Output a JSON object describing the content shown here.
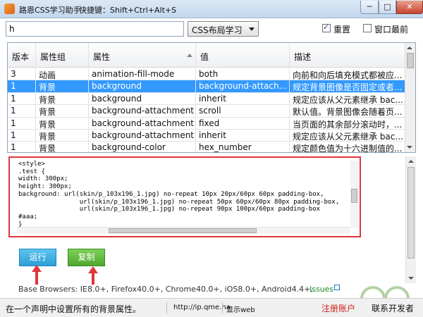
{
  "window": {
    "title": "路恩CSS学习助手",
    "shortcut": "快捷键：Shift+Ctrl+Alt+S",
    "minimize_symbol": "─",
    "maximize_symbol": "□",
    "close_symbol": "✕"
  },
  "toolbar": {
    "search_value": "h",
    "select_value": "CSS布局学习",
    "reset_label": "重置",
    "reset_checked": true,
    "topmost_label": "窗口最前",
    "topmost_checked": false
  },
  "table": {
    "headers": [
      "版本",
      "属性组",
      "属性",
      "值",
      "描述"
    ],
    "rows": [
      {
        "version": "3",
        "group": "动画",
        "property": "animation-fill-mode",
        "value": "both",
        "desc": "向前和向后填充模式都被应..."
      },
      {
        "version": "1",
        "group": "背景",
        "property": "background",
        "value": "background-attach...",
        "desc": "规定背景图像是否固定或者...",
        "selected": true
      },
      {
        "version": "1",
        "group": "背景",
        "property": "background",
        "value": "inherit",
        "desc": "规定应该从父元素继承 bac..."
      },
      {
        "version": "1",
        "group": "背景",
        "property": "background-attachment",
        "value": "scroll",
        "desc": "默认值。背景图像会随着页..."
      },
      {
        "version": "1",
        "group": "背景",
        "property": "background-attachment",
        "value": "fixed",
        "desc": "当页面的其余部分滚动时，..."
      },
      {
        "version": "1",
        "group": "背景",
        "property": "background-attachment",
        "value": "inherit",
        "desc": "规定应该从父元素继承 bac..."
      },
      {
        "version": "1",
        "group": "背景",
        "property": "background-color",
        "value": "hex_number",
        "desc": "规定颜色值为十六进制值的..."
      }
    ]
  },
  "code": {
    "text": "<style>\n.test {\nwidth: 300px;\nheight: 300px;\nbackground: url(skin/p_103x196_1.jpg) no-repeat 10px 20px/60px 60px padding-box,\n                url(skin/p_103x196_1.jpg) no-repeat 50px 60px/60px 80px padding-box,\n                url(skin/p_103x196_1.jpg) no-repeat 90px 100px/60px padding-box\n#aaa;\n}"
  },
  "buttons": {
    "run_label": "运行",
    "copy_label": "复制"
  },
  "footer": {
    "browsers": "Base Browsers: IE8.0+, Firefox40.0+, Chrome40.0+, iOS8.0+, Android4.4+,",
    "issues_label": "Issues"
  },
  "statusbar": {
    "description": "在一个声明中设置所有的背景属性。",
    "url": "http://ip.qme.na",
    "mode": "显示web",
    "register": "注册账户",
    "contact": "联系开发者"
  },
  "colors": {
    "selected_row": "#3399ff",
    "highlight_border": "#e0363a",
    "run_button": "#2d9ed6",
    "copy_button": "#4ea82c",
    "arrow": "#e0363a"
  }
}
